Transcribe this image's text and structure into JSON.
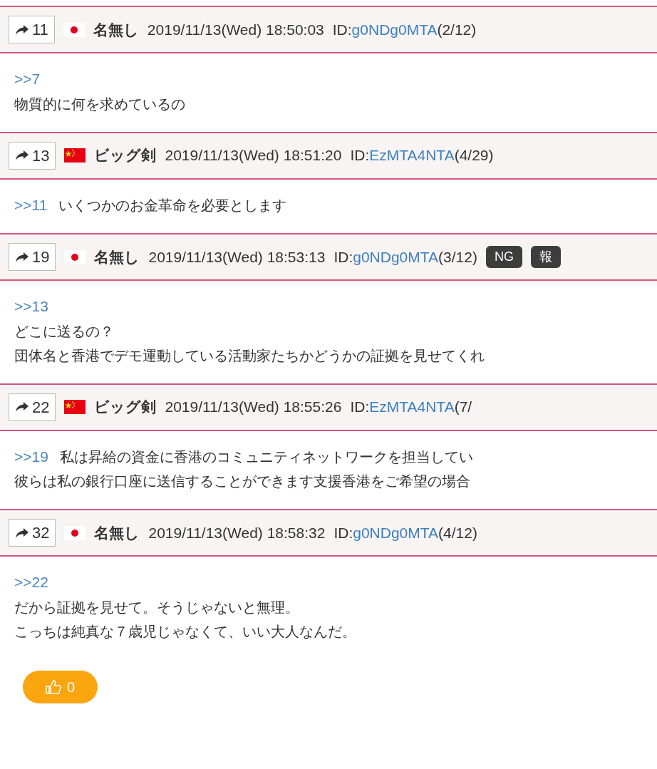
{
  "posts": [
    {
      "number": "11",
      "flag": {
        "kind": "jp"
      },
      "name": "名無し",
      "date": "2019/11/13(Wed) 18:50:03",
      "id_label": "ID:",
      "id": "g0NDg0MTA",
      "count": "(2/12)",
      "lines": [
        {
          "ref": ">>7"
        },
        {
          "text": "物質的に何を求めているの"
        }
      ]
    },
    {
      "number": "13",
      "flag": {
        "kind": "cn"
      },
      "name": "ビッグ剣",
      "date": "2019/11/13(Wed) 18:51:20",
      "id_label": "ID:",
      "id": "EzMTA4NTA",
      "count": "(4/29)",
      "lines": [
        {
          "ref": ">>11",
          "text": "いくつかのお金革命を必要とします"
        }
      ]
    },
    {
      "number": "19",
      "flag": {
        "kind": "jp"
      },
      "name": "名無し",
      "date": "2019/11/13(Wed) 18:53:13",
      "id_label": "ID:",
      "id": "g0NDg0MTA",
      "count": "(3/12)",
      "badges": [
        "NG",
        "報"
      ],
      "lines": [
        {
          "ref": ">>13"
        },
        {
          "text": "どこに送るの？"
        },
        {
          "text": "団体名と香港でデモ運動している活動家たちかどうかの証拠を見せてくれ"
        }
      ]
    },
    {
      "number": "22",
      "flag": {
        "kind": "cn"
      },
      "name": "ビッグ剣",
      "date": "2019/11/13(Wed) 18:55:26",
      "id_label": "ID:",
      "id": "EzMTA4NTA",
      "count": "(7/",
      "lines": [
        {
          "ref": ">>19",
          "text": "私は昇給の資金に香港のコミュニティネットワークを担当してい"
        },
        {
          "text": "彼らは私の銀行口座に送信することができます支援香港をご希望の場合"
        }
      ]
    },
    {
      "number": "32",
      "flag": {
        "kind": "jp"
      },
      "name": "名無し",
      "date": "2019/11/13(Wed) 18:58:32",
      "id_label": "ID:",
      "id": "g0NDg0MTA",
      "count": "(4/12)",
      "lines": [
        {
          "ref": ">>22"
        },
        {
          "text": "だから証拠を見せて。そうじゃないと無理。"
        },
        {
          "text": "こっちは純真な７歳児じゃなくて、いい大人なんだ。"
        }
      ]
    }
  ],
  "like": {
    "count": "0"
  }
}
